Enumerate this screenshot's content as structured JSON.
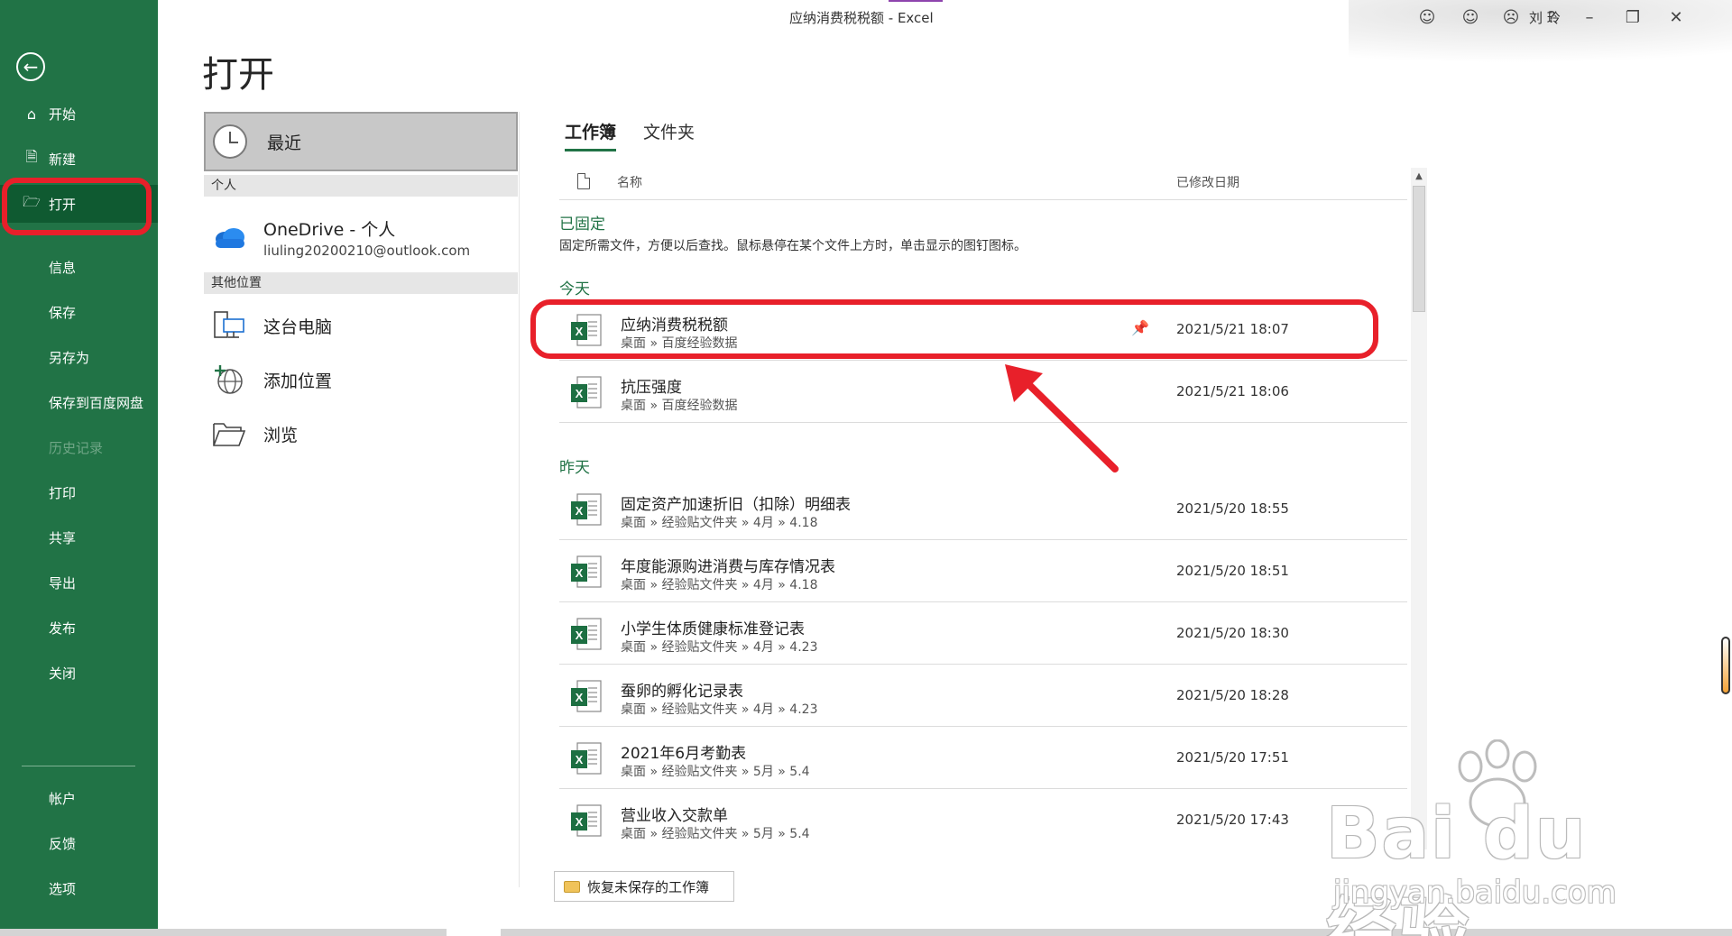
{
  "window": {
    "title": "应纳消费税税额 - Excel",
    "user": "刘 玲",
    "help": "?"
  },
  "nav": {
    "items": [
      {
        "label": "开始",
        "icon": "home-icon"
      },
      {
        "label": "新建",
        "icon": "new-doc-icon"
      },
      {
        "label": "打开",
        "icon": "open-folder-icon",
        "active": true
      },
      {
        "label": "信息"
      },
      {
        "label": "保存"
      },
      {
        "label": "另存为"
      },
      {
        "label": "保存到百度网盘"
      },
      {
        "label": "历史记录",
        "disabled": true
      },
      {
        "label": "打印"
      },
      {
        "label": "共享"
      },
      {
        "label": "导出"
      },
      {
        "label": "发布"
      },
      {
        "label": "关闭"
      }
    ],
    "bottom": [
      {
        "label": "帐户"
      },
      {
        "label": "反馈"
      },
      {
        "label": "选项"
      }
    ]
  },
  "page": {
    "title": "打开"
  },
  "locations": {
    "recent": "最近",
    "personal_header": "个人",
    "onedrive_title": "OneDrive - 个人",
    "onedrive_email": "liuling20200210@outlook.com",
    "other_header": "其他位置",
    "this_pc": "这台电脑",
    "add_place": "添加位置",
    "browse": "浏览"
  },
  "files": {
    "tabs": [
      "工作簿",
      "文件夹"
    ],
    "col_name": "名称",
    "col_date": "已修改日期",
    "pinned_label": "已固定",
    "pinned_desc": "固定所需文件，方便以后查找。鼠标悬停在某个文件上方时，单击显示的图钉图标。",
    "today_label": "今天",
    "yesterday_label": "昨天",
    "today": [
      {
        "name": "应纳消费税税额",
        "path": "桌面 » 百度经验数据",
        "date": "2021/5/21 18:07"
      },
      {
        "name": "抗压强度",
        "path": "桌面 » 百度经验数据",
        "date": "2021/5/21 18:06"
      }
    ],
    "yesterday": [
      {
        "name": "固定资产加速折旧（扣除）明细表",
        "path": "桌面 » 经验贴文件夹 » 4月 » 4.18",
        "date": "2021/5/20 18:55"
      },
      {
        "name": "年度能源购进消费与库存情况表",
        "path": "桌面 » 经验贴文件夹 » 4月 » 4.18",
        "date": "2021/5/20 18:51"
      },
      {
        "name": "小学生体质健康标准登记表",
        "path": "桌面 » 经验贴文件夹 » 4月 » 4.23",
        "date": "2021/5/20 18:30"
      },
      {
        "name": "蚕卵的孵化记录表",
        "path": "桌面 » 经验贴文件夹 » 4月 » 4.23",
        "date": "2021/5/20 18:28"
      },
      {
        "name": "2021年6月考勤表",
        "path": "桌面 » 经验贴文件夹 » 5月 » 5.4",
        "date": "2021/5/20 17:51"
      },
      {
        "name": "营业收入交款单",
        "path": "桌面 » 经验贴文件夹 » 5月 » 5.4",
        "date": "2021/5/20 17:43"
      }
    ],
    "recover_button": "恢复未保存的工作簿"
  },
  "watermark": {
    "brand": "Bai du 经验",
    "site": "jingyan.baidu.com"
  },
  "colors": {
    "excel_green": "#217346",
    "annotation_red": "#e8202a"
  }
}
